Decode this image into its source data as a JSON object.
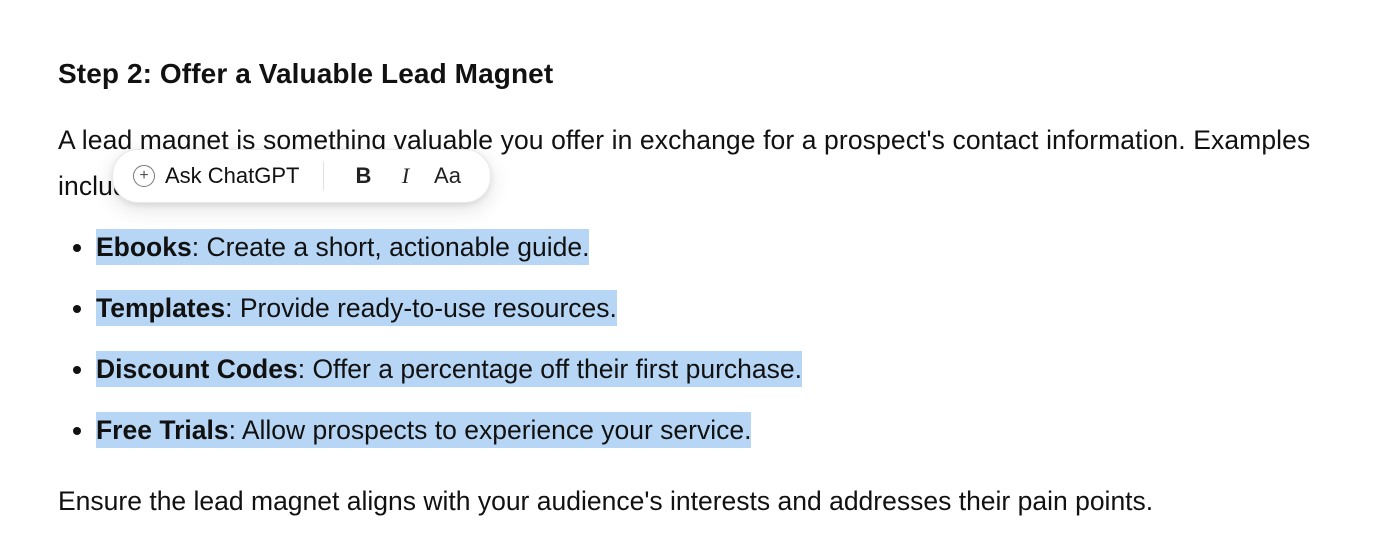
{
  "heading": "Step 2: Offer a Valuable Lead Magnet",
  "intro": "A lead magnet is something valuable you offer in exchange for a prospect's contact information. Examples include:",
  "list": [
    {
      "term": "Ebooks",
      "desc": ": Create a short, actionable guide."
    },
    {
      "term": "Templates",
      "desc": ": Provide ready-to-use resources."
    },
    {
      "term": "Discount Codes",
      "desc": ": Offer a percentage off their first purchase."
    },
    {
      "term": "Free Trials",
      "desc": ": Allow prospects to experience your service."
    }
  ],
  "outro": "Ensure the lead magnet aligns with your audience's interests and addresses their pain points.",
  "toolbar": {
    "ask_label": "Ask ChatGPT",
    "bold_label": "B",
    "italic_label": "I",
    "text_label": "Aa"
  }
}
